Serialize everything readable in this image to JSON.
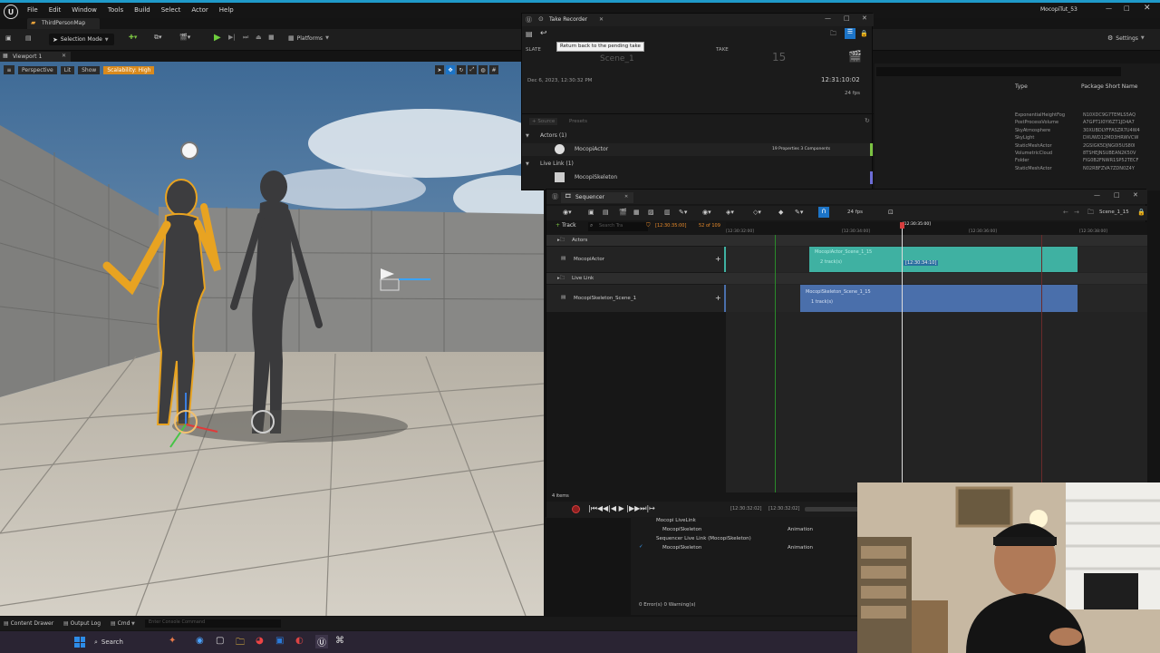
{
  "editor": {
    "project": "MocopiTut_53",
    "tab": "ThirdPersonMap",
    "menus": [
      "File",
      "Edit",
      "Window",
      "Tools",
      "Build",
      "Select",
      "Actor",
      "Help"
    ],
    "mode": "Selection Mode",
    "platforms": "Platforms",
    "settings": "Settings"
  },
  "viewport": {
    "tab": "Viewport 1",
    "perspective": "Perspective",
    "lit": "Lit",
    "show": "Show",
    "scalability": "Scalability: High"
  },
  "outliner": {
    "col_type": "Type",
    "col_pkg": "Package Short Name",
    "rows": [
      {
        "type": "ExponentialHeightFog",
        "pkg": "N10XDC9G7TEMLS5AQ"
      },
      {
        "type": "PostProcessVolume",
        "pkg": "A7GPT1I0YI6ZT1JD4A7"
      },
      {
        "type": "SkyAtmosphere",
        "pkg": "30XUBDLYFFASZR7U4W4"
      },
      {
        "type": "SkyLight",
        "pkg": "DXUWD12MD3HRWVCW"
      },
      {
        "type": "StaticMeshActor",
        "pkg": "2GSIGK5DJNG0I5US80I"
      },
      {
        "type": "VolumetricCloud",
        "pkg": "8TSHEJNSUBEAN2K50V"
      },
      {
        "type": "Folder",
        "pkg": "FIG0B2FNWR1SP52TECF"
      },
      {
        "type": "StaticMeshActor",
        "pkg": "N02RBFZVA7ZDN0Z4Y"
      }
    ]
  },
  "take_recorder": {
    "title": "Take Recorder",
    "tooltip": "Return back to the pending take",
    "slate_label": "SLATE",
    "slate_value": "Scene_1",
    "take_label": "TAKE",
    "take_value": "15",
    "date": "Dec 6, 2023, 12:30:32 PM",
    "timecode": "12:31:10:02",
    "fps": "24 fps",
    "source": "+ Source",
    "presets": "Presets",
    "actors_group": "Actors (1)",
    "actor_name": "MocopiActor",
    "actor_props": "19 Properties 3 Components",
    "livelink_group": "Live Link (1)",
    "livelink_name": "MocopiSkeleton"
  },
  "sequencer": {
    "title": "Sequencer",
    "fps": "24 fps",
    "scene": "Scene_1_15",
    "track_btn": "Track",
    "search_placeholder": "Search Tra",
    "current_time": "[12:30:35:00]",
    "frame_count": "52 of 109",
    "ticks": [
      "[12:30:32:00]",
      "[12:30:34:00]",
      "[12:30:35:00]",
      "[12:30:36:00]",
      "[12:30:38:00]"
    ],
    "tracks": [
      {
        "label": "Actors",
        "kind": "folder"
      },
      {
        "label": "MocopiActor",
        "kind": "item"
      },
      {
        "label": "Live Link",
        "kind": "folder"
      },
      {
        "label": "MocopiSkeleton_Scene_1",
        "kind": "item"
      }
    ],
    "clip1_title": "MocopiActor_Scene_1_15",
    "clip1_sub": "2 track(s)",
    "clip1_marker": "[12:30:34:10]",
    "clip2_title": "MocopiSkeleton_Scene_1_15",
    "clip2_sub": "1 track(s)",
    "items_count": "4 items",
    "start_tc": "[12:30:32:02]",
    "end_tc": "[12:30:32:02]"
  },
  "log": {
    "rows": [
      {
        "name": "Mocopi LiveLink",
        "type": ""
      },
      {
        "name": "MocopiSkeleton",
        "type": "Animation"
      },
      {
        "name": "Sequencer Live Link (MocopiSkeleton)",
        "type": ""
      },
      {
        "name": "MocopiSkeleton",
        "type": "Animation"
      }
    ],
    "status": "0 Error(s)  0 Warning(s)"
  },
  "bottom_bar": {
    "content_drawer": "Content Drawer",
    "output_log": "Output Log",
    "cmd": "Cmd",
    "console_placeholder": "Enter Console Command"
  },
  "taskbar": {
    "search": "Search"
  }
}
